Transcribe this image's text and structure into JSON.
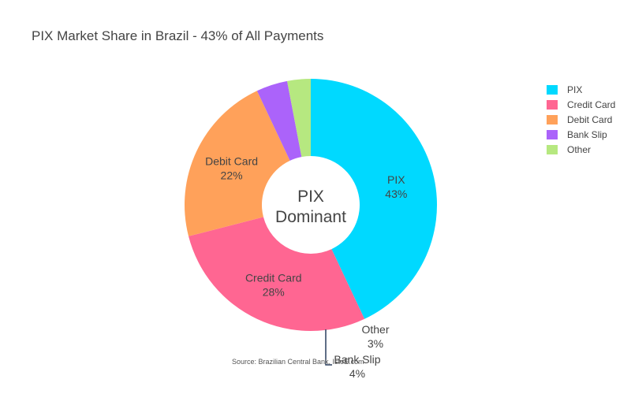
{
  "chart_data": {
    "type": "pie",
    "title": "PIX Market Share in Brazil - 43% of All Payments",
    "center_label": [
      "PIX",
      "Dominant"
    ],
    "categories": [
      "PIX",
      "Credit Card",
      "Debit Card",
      "Bank Slip",
      "Other"
    ],
    "values": [
      43,
      28,
      22,
      4,
      3
    ],
    "slice_labels": [
      {
        "name": "PIX",
        "percent": "43%"
      },
      {
        "name": "Credit Card",
        "percent": "28%"
      },
      {
        "name": "Debit Card",
        "percent": "22%"
      },
      {
        "name": "Bank Slip",
        "percent": "4%"
      },
      {
        "name": "Other",
        "percent": "3%"
      }
    ],
    "colors": [
      "#00d9ff",
      "#ff6692",
      "#ffa15a",
      "#ab63fa",
      "#b6e880"
    ],
    "legend_placement": "top-right",
    "source": "Source: Brazilian Central Bank, IstoÉ.com"
  }
}
